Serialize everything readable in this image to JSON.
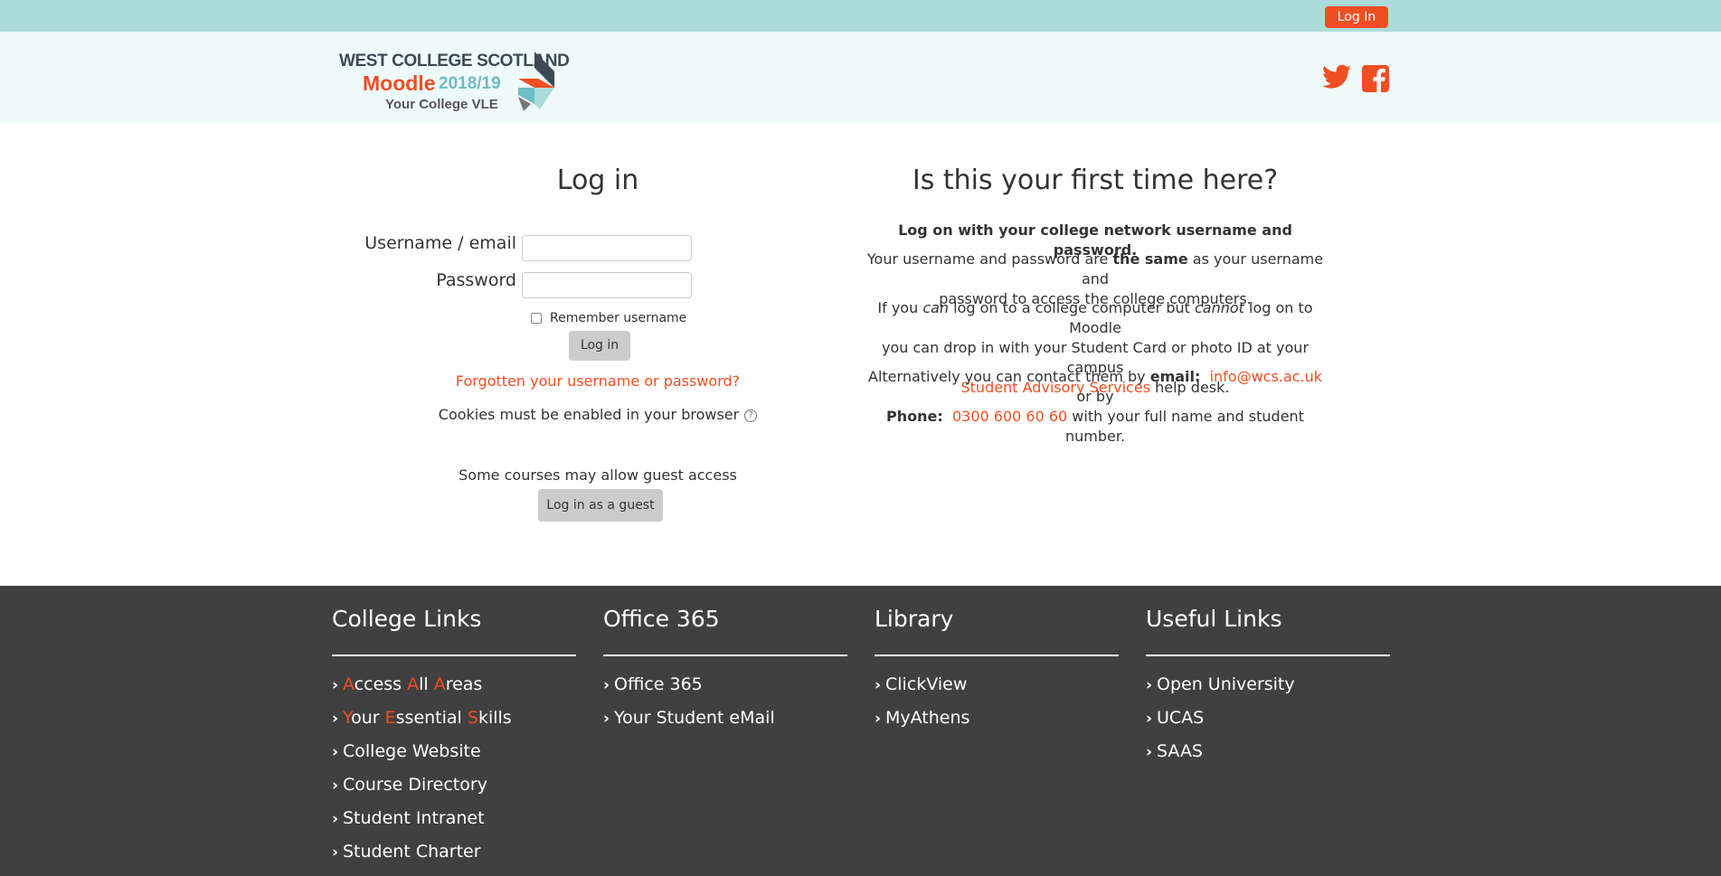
{
  "topbar": {
    "login_label": "Log In"
  },
  "logo": {
    "line1": "WEST COLLEGE SCOTLAND",
    "line2_brand": "Moodle",
    "line2_year": "2018/19",
    "line3": "Your College VLE"
  },
  "social": {
    "twitter_icon": "twitter-icon",
    "facebook_icon": "facebook-icon"
  },
  "login": {
    "title": "Log in",
    "username_label": "Username / email",
    "password_label": "Password",
    "remember_label": "Remember username",
    "submit_label": "Log in",
    "forgot_link": "Forgotten your username or password?",
    "cookies_text": "Cookies must be enabled in your browser",
    "guest_text": "Some courses may allow guest access",
    "guest_button": "Log in as a guest"
  },
  "info": {
    "title": "Is this your first time here?",
    "lead": "Log on with your college network username and password.",
    "p1_a": "Your username and password are ",
    "p1_bold": "the same",
    "p1_b": " as your username and",
    "p1_c": "password to access the college computers.",
    "p2_a": "If you ",
    "p2_can": "can",
    "p2_b": " log on to a college computer but ",
    "p2_cannot": "cannot",
    "p2_c": " log on to Moodle",
    "p2_d": "you can drop in with your Student Card or photo ID at your campus",
    "p2_link": "Student Advisory Services",
    "p2_e": " help desk.",
    "p3_a": "Alternatively you can contact them by ",
    "p3_email_label": "email:",
    "p3_email": "info@wcs.ac.uk",
    "p3_b": " or by",
    "p3_phone_label": "Phone:",
    "p3_phone": "0300 600 60 60",
    "p3_c": " with your full name and student number."
  },
  "footer": {
    "college": {
      "title": "College Links",
      "items": [
        "College Website",
        "Course Directory",
        "Student Intranet",
        "Student Charter"
      ],
      "aaa": {
        "a1": "A",
        "r1": "ccess ",
        "a2": "A",
        "r2": "ll ",
        "a3": "A",
        "r3": "reas"
      },
      "yes": {
        "a1": "Y",
        "r1": "our ",
        "a2": "E",
        "r2": "ssential ",
        "a3": "S",
        "r3": "kills"
      }
    },
    "office": {
      "title": "Office 365",
      "items": [
        "Office 365",
        "Your Student eMail"
      ]
    },
    "library": {
      "title": "Library",
      "items": [
        "ClickView",
        "MyAthens"
      ]
    },
    "useful": {
      "title": "Useful Links",
      "items": [
        "Open University",
        "UCAS",
        "SAAS"
      ]
    }
  },
  "colors": {
    "accent": "#f04e23",
    "topbar": "#acdcd9",
    "header": "#effbfa",
    "footer": "#404040"
  }
}
